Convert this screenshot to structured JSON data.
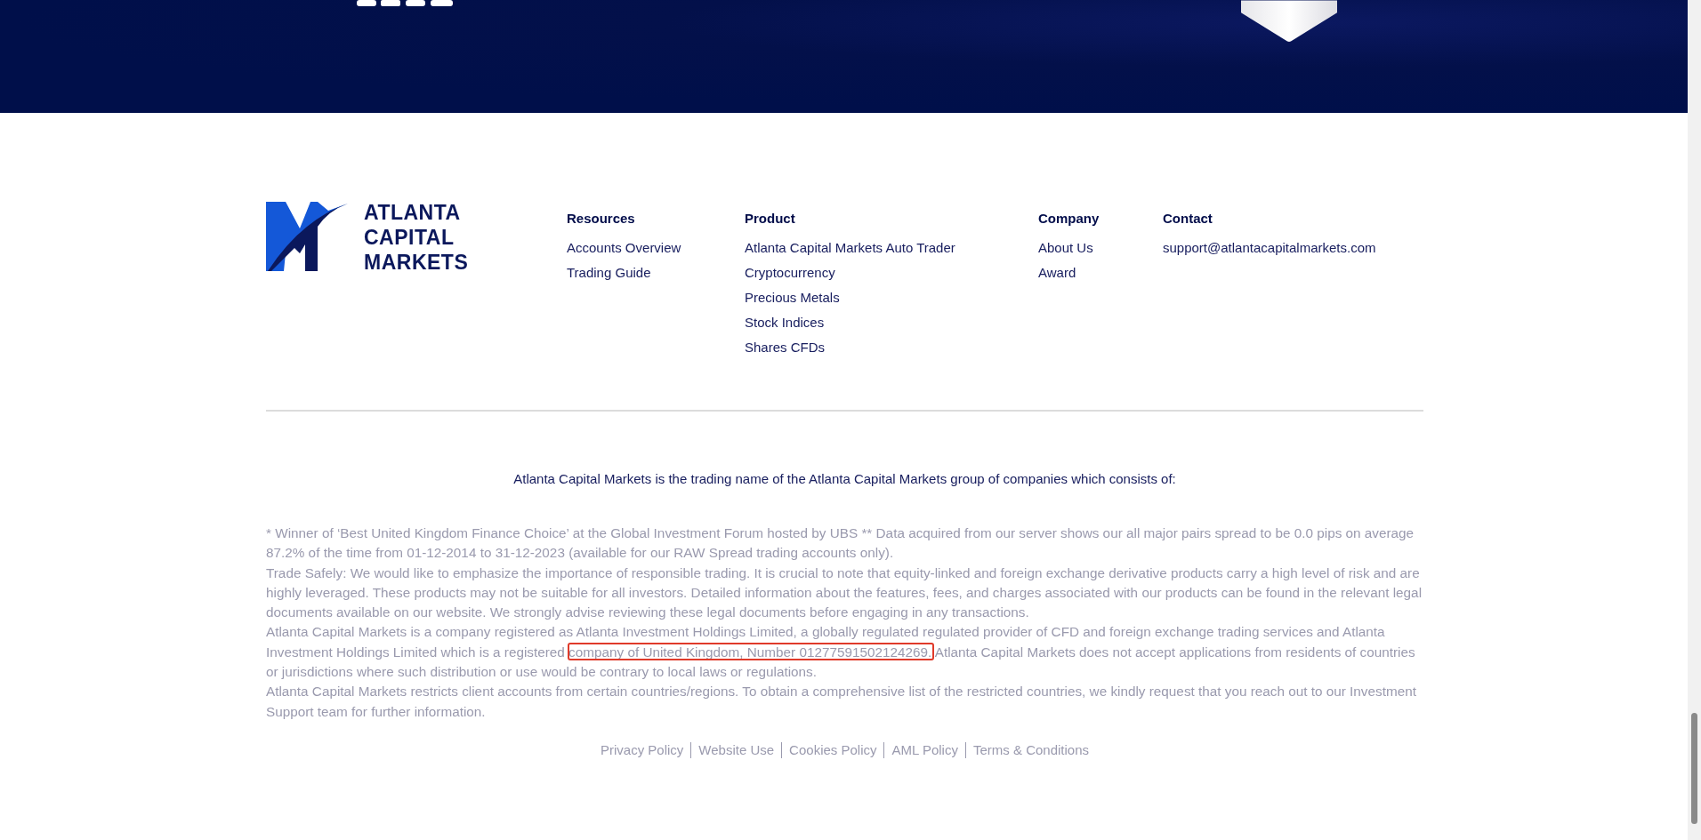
{
  "brand": {
    "lines": [
      "ATLANTA",
      "CAPITAL",
      "MARKETS"
    ]
  },
  "footer_columns": [
    {
      "heading": "Resources",
      "links": [
        "Accounts Overview",
        "Trading Guide"
      ]
    },
    {
      "heading": "Product",
      "links": [
        "Atlanta Capital Markets Auto Trader",
        "Cryptocurrency",
        "Precious Metals",
        "Stock Indices",
        "Shares CFDs"
      ]
    },
    {
      "heading": "Company",
      "links": [
        "About Us",
        "Award"
      ]
    },
    {
      "heading": "Contact",
      "links": [
        "support@atlantacapitalmarkets.com"
      ]
    }
  ],
  "group_note": "Atlanta Capital Markets is the trading name of the Atlanta Capital Markets group of companies which consists of:",
  "disclaimer": [
    {
      "parts": [
        {
          "text": "* Winner of ‘Best United Kingdom Finance Choice’ at the Global Investment Forum hosted by UBS ** Data acquired from our server shows our all major pairs spread to be 0.0 pips on average 87.2% of the time from 01-12-2014 to 31-12-2023 (available for our RAW Spread trading accounts only)."
        }
      ]
    },
    {
      "parts": [
        {
          "text": "Trade Safely: We would like to emphasize the importance of responsible trading. It is crucial to note that equity-linked and foreign exchange derivative products carry a high level of risk and are highly leveraged. These products may not be suitable for all investors. Detailed information about the features, fees, and charges associated with our products can be found in the relevant legal documents available on our website. We strongly advise reviewing these legal documents before engaging in any transactions."
        }
      ]
    },
    {
      "parts": [
        {
          "text": "Atlanta Capital Markets is a company registered as Atlanta Investment Holdings Limited, a globally regulated regulated provider of CFD and foreign exchange trading services and Atlanta Investment Holdings Limited which is a registered "
        },
        {
          "text": "company of United Kingdom, Number 01277591502124269.",
          "highlighted": true
        },
        {
          "text": " Atlanta Capital Markets does not accept applications from residents of countries or jurisdictions where such distribution or use would be contrary to local laws or regulations."
        }
      ]
    },
    {
      "parts": [
        {
          "text": "Atlanta Capital Markets restricts client accounts from certain countries/regions. To obtain a comprehensive list of the restricted countries, we kindly request that you reach out to our Investment Support team for further information."
        }
      ]
    }
  ],
  "legal_links": [
    "Privacy Policy",
    "Website Use",
    "Cookies Policy",
    "AML Policy",
    "Terms & Conditions"
  ]
}
